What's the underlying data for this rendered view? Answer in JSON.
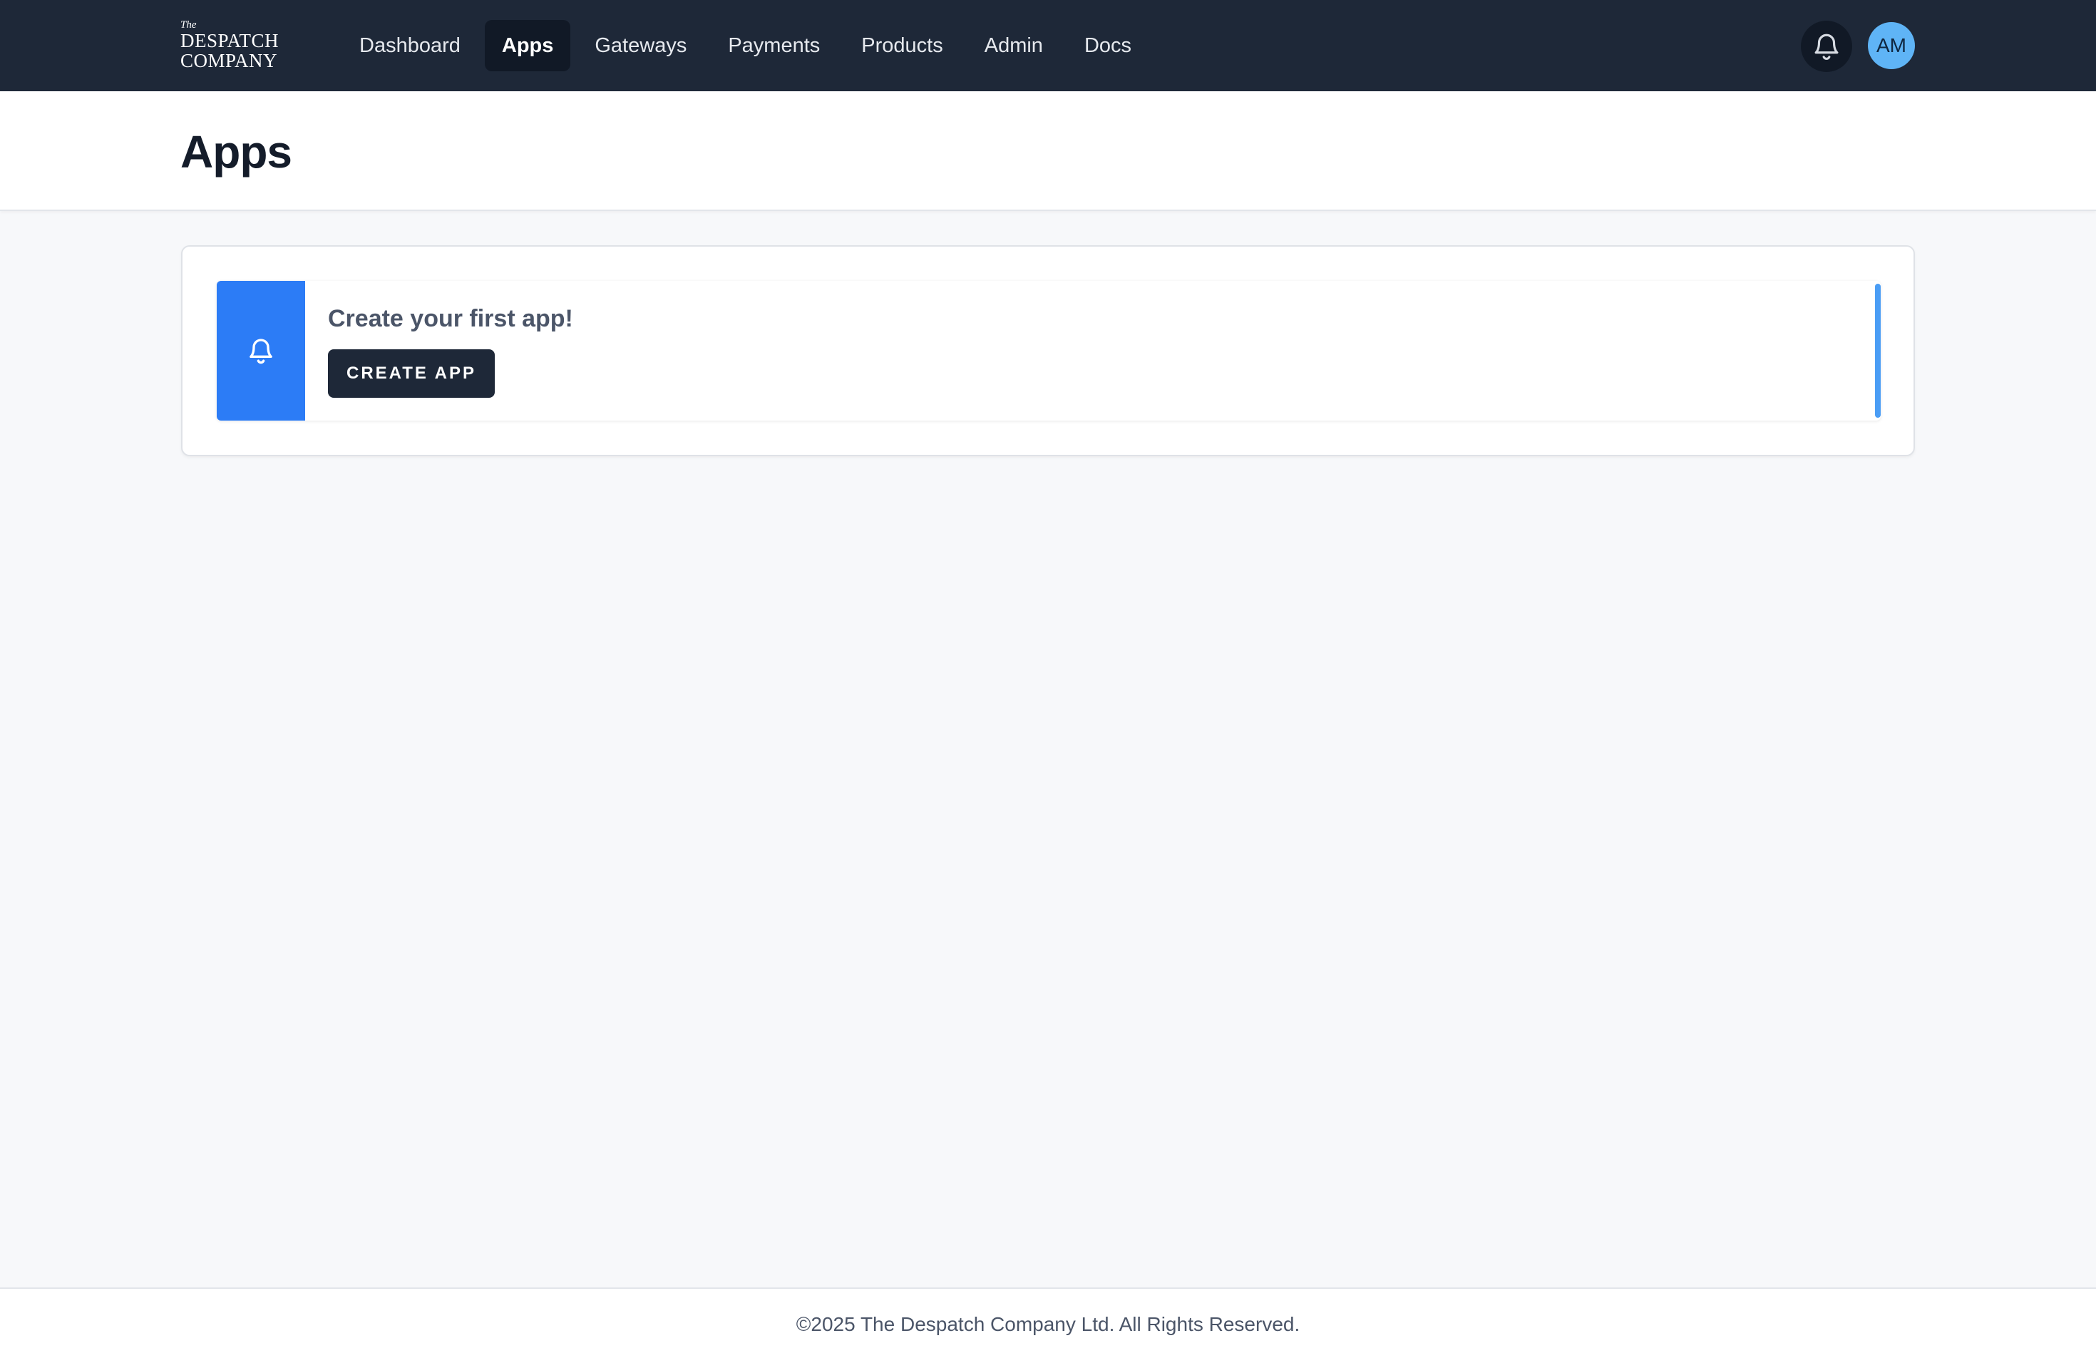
{
  "brand": {
    "logo_the": "The",
    "logo_line1": "DESPATCH",
    "logo_line2": "COMPANY"
  },
  "nav": {
    "items": [
      {
        "label": "Dashboard",
        "active": false
      },
      {
        "label": "Apps",
        "active": true
      },
      {
        "label": "Gateways",
        "active": false
      },
      {
        "label": "Payments",
        "active": false
      },
      {
        "label": "Products",
        "active": false
      },
      {
        "label": "Admin",
        "active": false
      },
      {
        "label": "Docs",
        "active": false
      }
    ]
  },
  "header_actions": {
    "notifications_icon": "bell-icon",
    "avatar_initials": "AM"
  },
  "page": {
    "title": "Apps"
  },
  "empty_state": {
    "icon": "bell-icon",
    "title": "Create your first app!",
    "button_label": "CREATE APP"
  },
  "footer": {
    "text": "©2025 The Despatch Company Ltd. All Rights Reserved."
  },
  "colors": {
    "topbar": "#1e2838",
    "accent": "#2c7cf6",
    "avatar": "#5fb4f6",
    "page_bg": "#f7f8fa"
  }
}
